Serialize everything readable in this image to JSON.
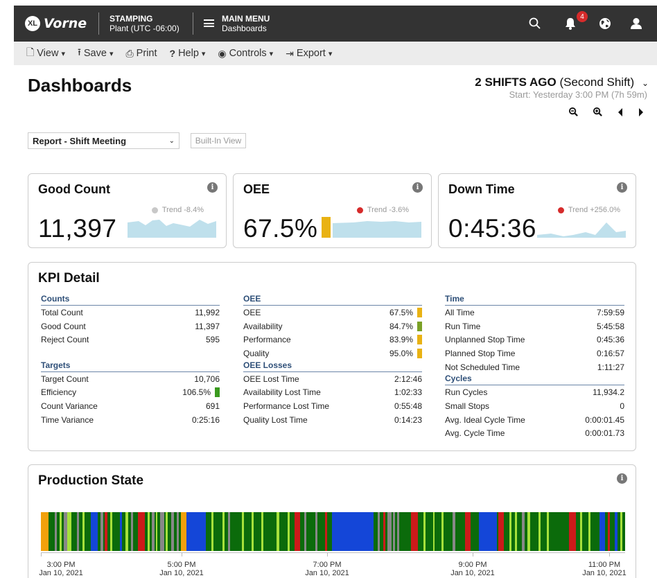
{
  "app": {
    "logo_badge": "XL",
    "logo_text": "Vorne",
    "location_title": "STAMPING",
    "location_sub": "Plant (UTC -06:00)",
    "menu_title": "MAIN MENU",
    "menu_sub": "Dashboards",
    "notification_count": "4"
  },
  "toolbar": {
    "view": "View",
    "save": "Save",
    "print": "Print",
    "help": "Help",
    "controls": "Controls",
    "export": "Export"
  },
  "page": {
    "title": "Dashboards",
    "shift_bold": "2 SHIFTS AGO",
    "shift_rest": " (Second Shift)",
    "shift_sub": "Start: Yesterday 3:00 PM (7h 59m)",
    "view_select": "Report - Shift Meeting",
    "builtin_label": "Built-In View"
  },
  "cards": {
    "good_count": {
      "title": "Good Count",
      "trend": "Trend -8.4%",
      "trend_color": "#c8c8c8",
      "value": "11,397"
    },
    "oee": {
      "title": "OEE",
      "trend": "Trend -3.6%",
      "trend_color": "#d62b2b",
      "value": "67.5%"
    },
    "down_time": {
      "title": "Down Time",
      "trend": "Trend +256.0%",
      "trend_color": "#d62b2b",
      "value": "0:45:36"
    }
  },
  "kpi": {
    "title": "KPI Detail",
    "counts": {
      "title": "Counts",
      "rows": [
        {
          "label": "Total Count",
          "value": "11,992"
        },
        {
          "label": "Good Count",
          "value": "11,397"
        },
        {
          "label": "Reject Count",
          "value": "595"
        }
      ]
    },
    "targets": {
      "title": "Targets",
      "rows": [
        {
          "label": "Target Count",
          "value": "10,706"
        },
        {
          "label": "Efficiency",
          "value": "106.5%"
        },
        {
          "label": "Count Variance",
          "value": "691"
        },
        {
          "label": "Time Variance",
          "value": "0:25:16"
        }
      ]
    },
    "oee": {
      "title": "OEE",
      "rows": [
        {
          "label": "OEE",
          "value": "67.5%"
        },
        {
          "label": "Availability",
          "value": "84.7%"
        },
        {
          "label": "Performance",
          "value": "83.9%"
        },
        {
          "label": "Quality",
          "value": "95.0%"
        }
      ]
    },
    "oee_losses": {
      "title": "OEE Losses",
      "rows": [
        {
          "label": "OEE Lost Time",
          "value": "2:12:46"
        },
        {
          "label": "Availability Lost Time",
          "value": "1:02:33"
        },
        {
          "label": "Performance Lost Time",
          "value": "0:55:48"
        },
        {
          "label": "Quality Lost Time",
          "value": "0:14:23"
        }
      ]
    },
    "time": {
      "title": "Time",
      "rows": [
        {
          "label": "All Time",
          "value": "7:59:59"
        },
        {
          "label": "Run Time",
          "value": "5:45:58"
        },
        {
          "label": "Unplanned Stop Time",
          "value": "0:45:36"
        },
        {
          "label": "Planned Stop Time",
          "value": "0:16:57"
        },
        {
          "label": "Not Scheduled Time",
          "value": "1:11:27"
        }
      ]
    },
    "cycles": {
      "title": "Cycles",
      "rows": [
        {
          "label": "Run Cycles",
          "value": "11,934.2"
        },
        {
          "label": "Small Stops",
          "value": "0"
        },
        {
          "label": "Avg. Ideal Cycle Time",
          "value": "0:00:01.45"
        },
        {
          "label": "Avg. Cycle Time",
          "value": "0:00:01.73"
        }
      ]
    },
    "colors": {
      "yellow": "#e9b213",
      "green": "#3a9a1e"
    }
  },
  "production": {
    "title": "Production State",
    "time_labels": [
      {
        "time": "3:00 PM",
        "date": "Jan 10, 2021"
      },
      {
        "time": "5:00 PM",
        "date": "Jan 10, 2021"
      },
      {
        "time": "7:00 PM",
        "date": "Jan 10, 2021"
      },
      {
        "time": "9:00 PM",
        "date": "Jan 10, 2021"
      },
      {
        "time": "11:00 PM",
        "date": "Jan 10, 2021"
      }
    ],
    "state_colors": {
      "running": "#0b6b0b",
      "down": "#1446d8",
      "stopped": "#cc1a1a",
      "small_stop": "#a6e13b",
      "not_scheduled": "#888888",
      "setup": "#f2a10b"
    }
  }
}
